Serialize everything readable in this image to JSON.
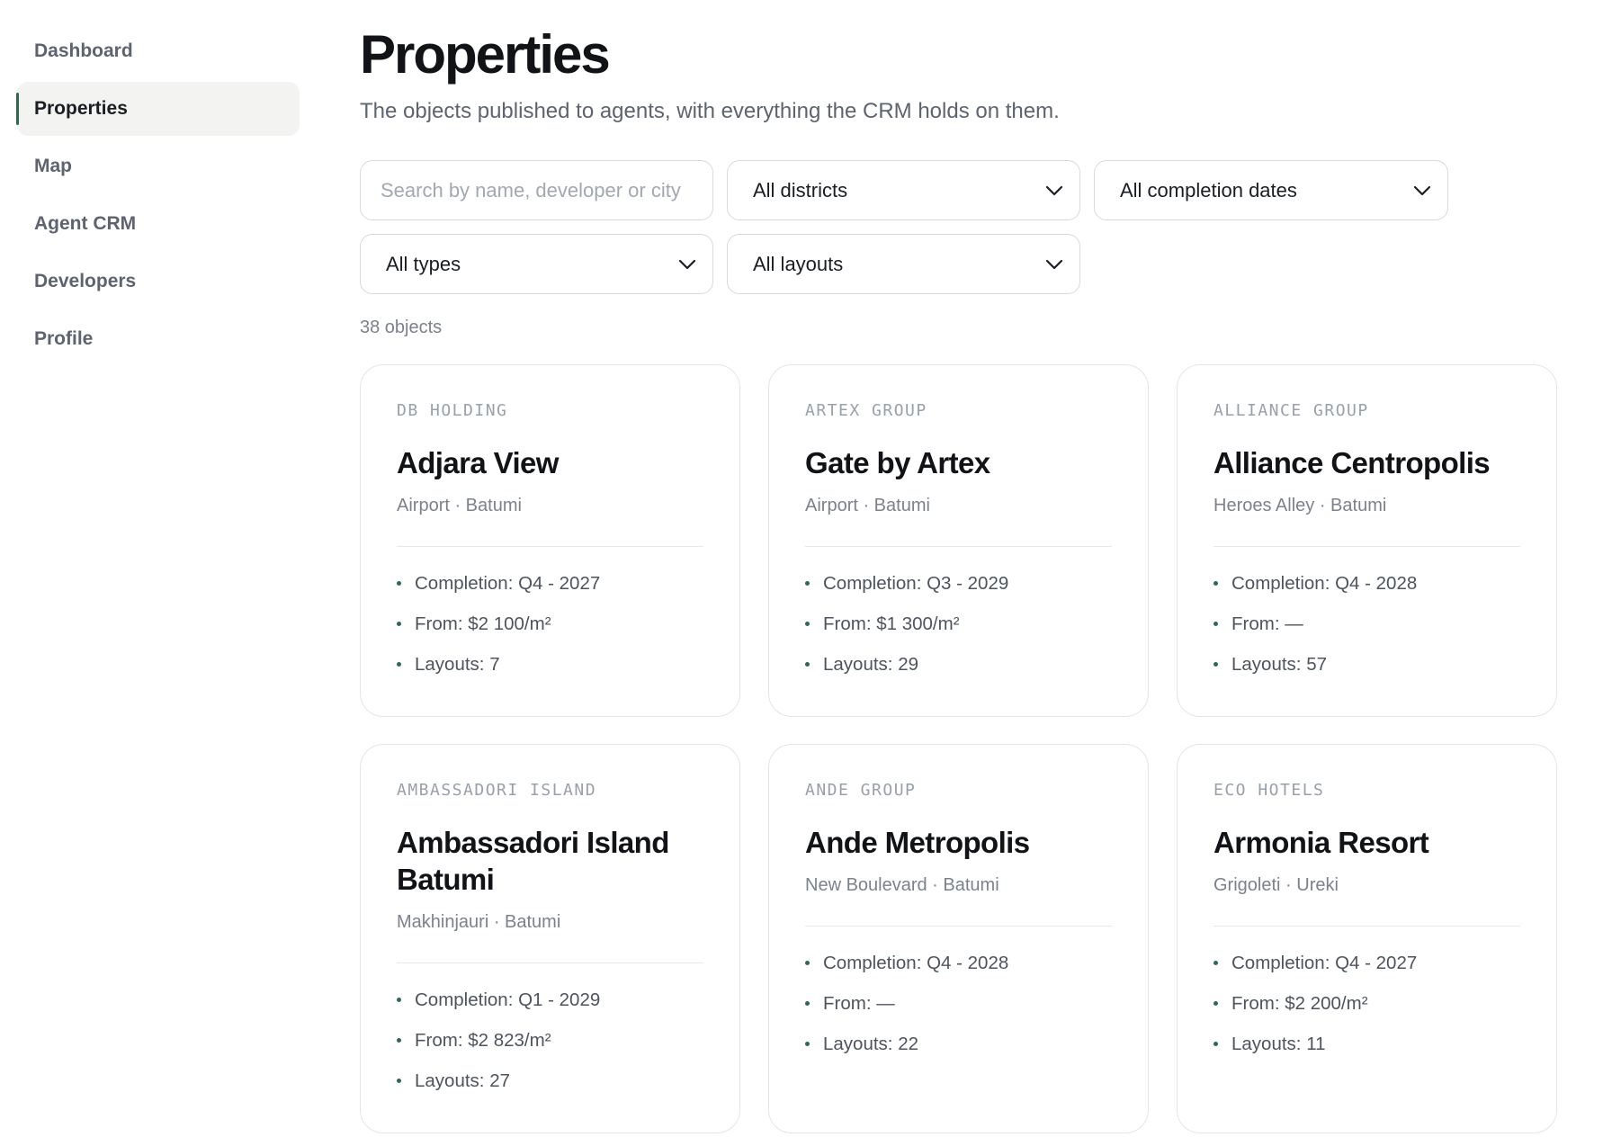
{
  "sidebar": {
    "items": [
      {
        "label": "Dashboard",
        "active": false
      },
      {
        "label": "Properties",
        "active": true
      },
      {
        "label": "Map",
        "active": false
      },
      {
        "label": "Agent CRM",
        "active": false
      },
      {
        "label": "Developers",
        "active": false
      },
      {
        "label": "Profile",
        "active": false
      }
    ],
    "accent_color": "#2f6a4f"
  },
  "header": {
    "title": "Properties",
    "subtitle": "The objects published to agents, with everything the CRM holds on them."
  },
  "filters": {
    "search_placeholder": "Search by name, developer or city",
    "district": "All districts",
    "completion": "All completion dates",
    "type": "All types",
    "layouts": "All layouts"
  },
  "results": {
    "count_label": "38 objects"
  },
  "cards": [
    {
      "developer": "DB HOLDING",
      "name": "Adjara View",
      "location": "Airport · Batumi",
      "completion": "Completion: Q4 - 2027",
      "price": "From: $2 100/m²",
      "layouts": "Layouts: 7"
    },
    {
      "developer": "ARTEX GROUP",
      "name": "Gate by Artex",
      "location": "Airport · Batumi",
      "completion": "Completion: Q3 - 2029",
      "price": "From: $1 300/m²",
      "layouts": "Layouts: 29"
    },
    {
      "developer": "ALLIANCE GROUP",
      "name": "Alliance Centropolis",
      "location": "Heroes Alley · Batumi",
      "completion": "Completion: Q4 - 2028",
      "price": "From: —",
      "layouts": "Layouts: 57"
    },
    {
      "developer": "AMBASSADORI ISLAND",
      "name": "Ambassadori Island Batumi",
      "location": "Makhinjauri · Batumi",
      "completion": "Completion: Q1 - 2029",
      "price": "From: $2 823/m²",
      "layouts": "Layouts: 27"
    },
    {
      "developer": "ANDE GROUP",
      "name": "Ande Metropolis",
      "location": "New Boulevard · Batumi",
      "completion": "Completion: Q4 - 2028",
      "price": "From: —",
      "layouts": "Layouts: 22"
    },
    {
      "developer": "ECO HOTELS",
      "name": "Armonia Resort",
      "location": "Grigoleti · Ureki",
      "completion": "Completion: Q4 - 2027",
      "price": "From: $2 200/m²",
      "layouts": "Layouts: 11"
    }
  ]
}
